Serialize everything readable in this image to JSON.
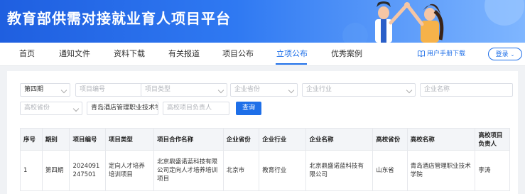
{
  "header": {
    "title": "教育部供需对接就业育人项目平台"
  },
  "nav": {
    "items": [
      "首页",
      "通知文件",
      "资料下载",
      "有关报道",
      "项目公布",
      "立项公布",
      "优秀案例"
    ],
    "active": "立项公布",
    "manual": "用户手册下载",
    "login": "登录"
  },
  "filters": {
    "period": "第四期",
    "project_no_placeholder": "项目编号",
    "project_type_placeholder": "项目类型",
    "company_province_placeholder": "企业省份",
    "company_industry_placeholder": "企业行业",
    "company_name_placeholder": "企业名称",
    "college_province_placeholder": "高校省份",
    "college_name": "青岛酒店管理职业技术学院",
    "college_leader_placeholder": "高校项目负责人",
    "search_label": "查询"
  },
  "table": {
    "headers": [
      "序号",
      "期别",
      "项目编号",
      "项目类型",
      "项目合作名称",
      "企业省份",
      "企业行业",
      "企业名称",
      "高校省份",
      "高校名称",
      "高校项目负责人"
    ],
    "rows": [
      [
        "1",
        "第四期",
        "2024091247501",
        "定向人才培养培训项目",
        "北京鼎盛诺蓝科技有限公司定向人才培养培训项目",
        "北京市",
        "教育行业",
        "北京鼎盛诺蓝科技有限公司",
        "山东省",
        "青岛酒店管理职业技术学院",
        "李涛"
      ]
    ]
  },
  "colors": {
    "accent": "#1e6fe8",
    "banner_start": "#1f5fe0",
    "banner_end": "#7fb6ff"
  }
}
